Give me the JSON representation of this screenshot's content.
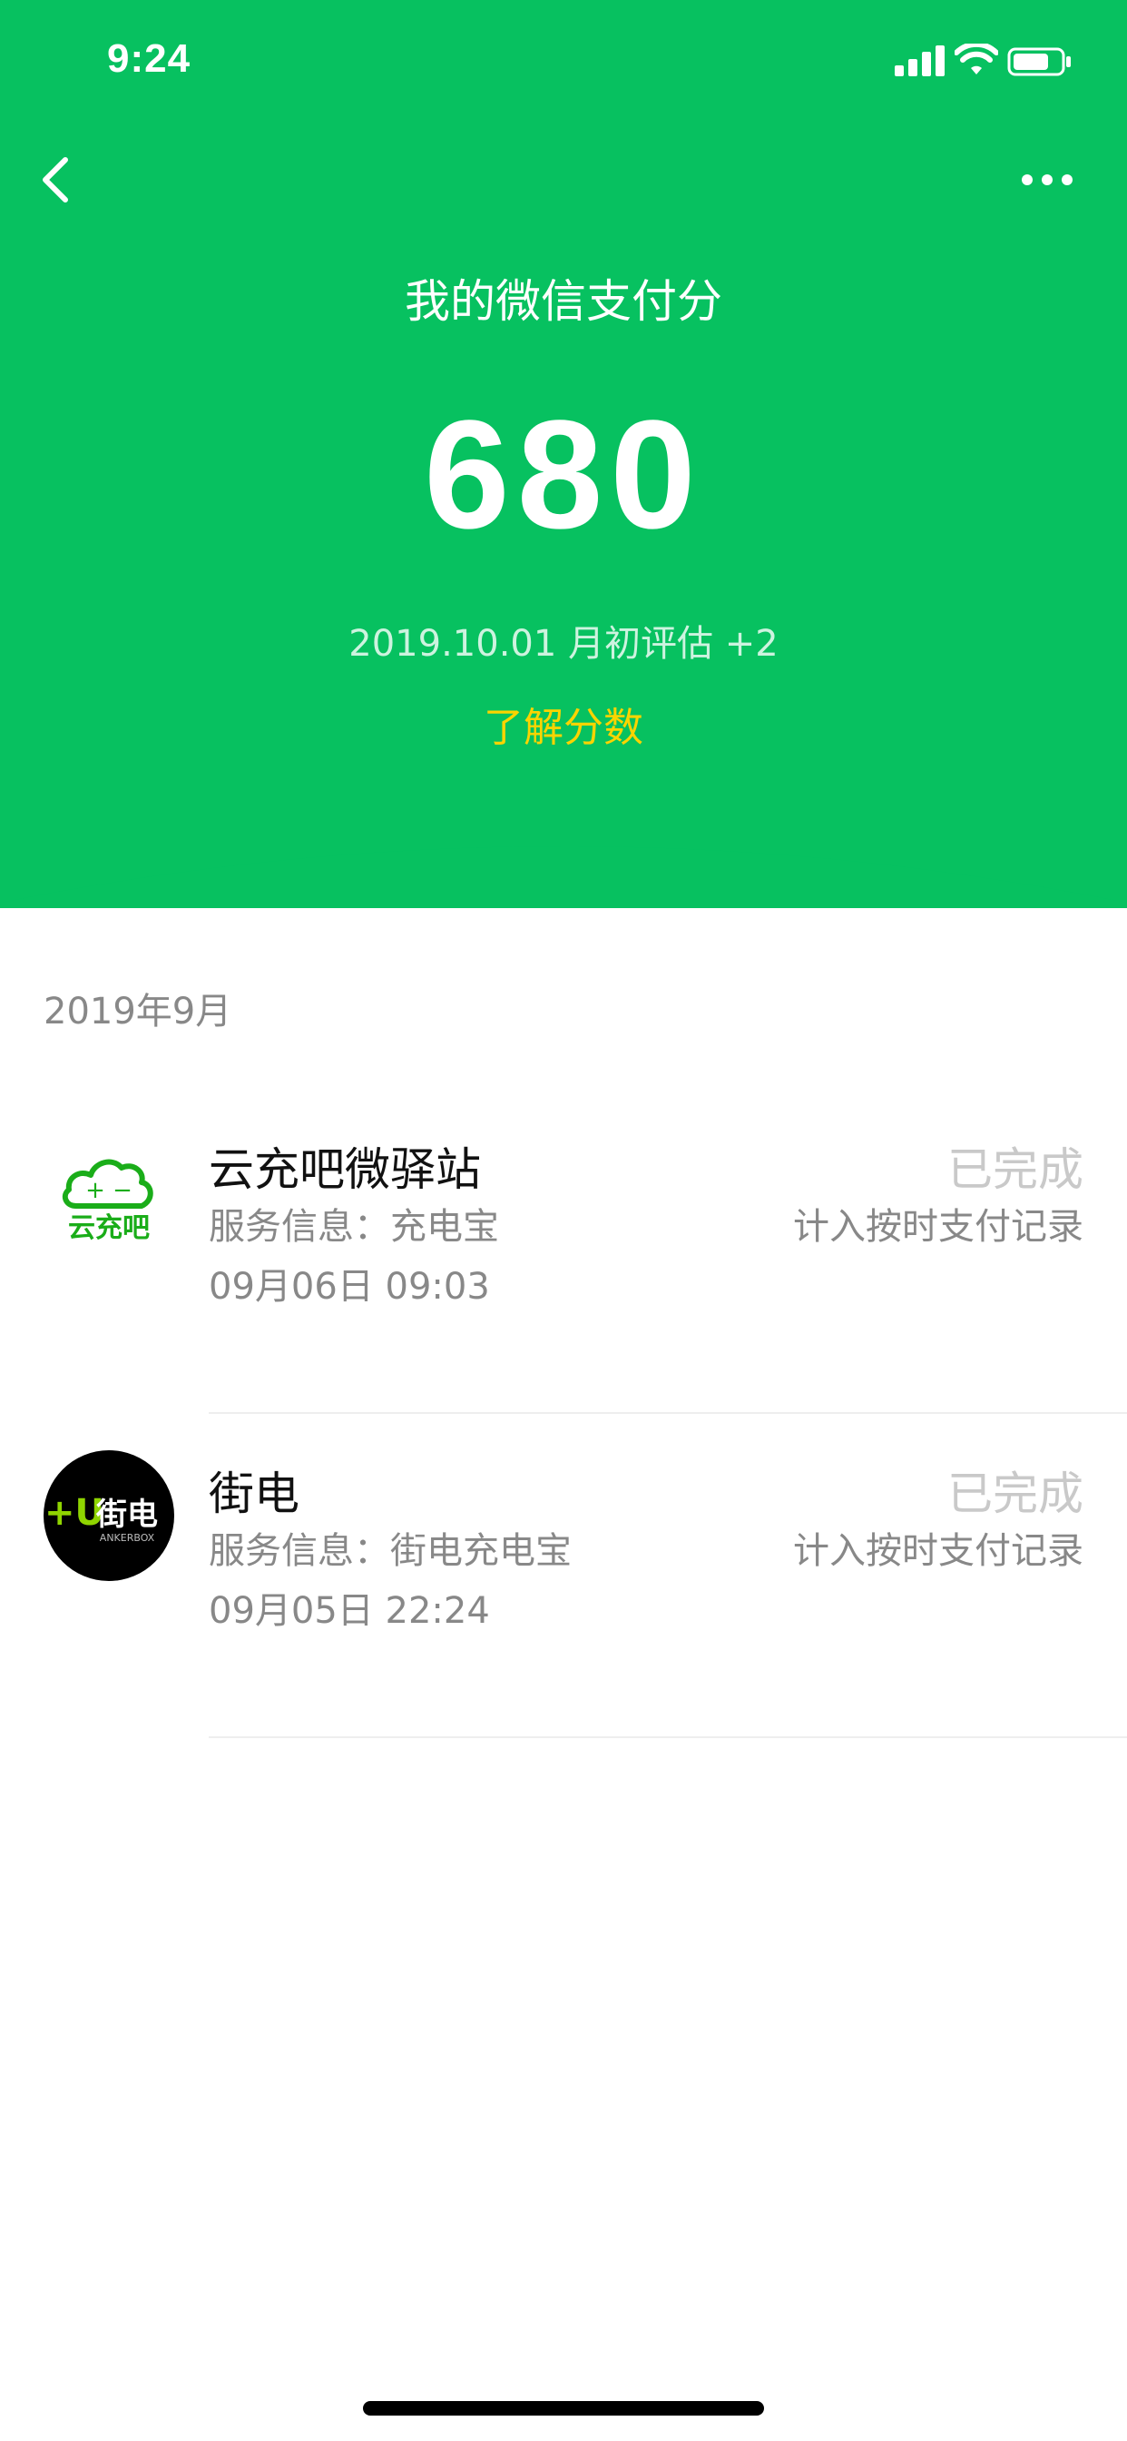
{
  "theme": {
    "green": "#07C160",
    "accent": "#FAD400"
  },
  "status_bar": {
    "time": "9:24"
  },
  "header": {
    "title": "我的微信支付分",
    "score": "680",
    "subtitle": "2019.10.01 月初评估 +2",
    "learn_link": "了解分数"
  },
  "month_label": "2019年9月",
  "records": [
    {
      "merchant": "云充吧微驿站",
      "service": "服务信息：充电宝",
      "time": "09月06日 09:03",
      "status": "已完成",
      "record": "计入按时支付记录",
      "logo_text": "云充吧",
      "logo_symbols": "+ −"
    },
    {
      "merchant": "街电",
      "service": "服务信息：街电充电宝",
      "time": "09月05日 22:24",
      "status": "已完成",
      "record": "计入按时支付记录",
      "logo_text": "街电",
      "logo_sub": "ANKERBOX",
      "logo_mark": "+U"
    }
  ],
  "icons": {
    "back": "chevron-left-icon",
    "more": "more-dots-icon",
    "signal": "cellular-signal-icon",
    "wifi": "wifi-icon",
    "battery": "battery-icon"
  }
}
